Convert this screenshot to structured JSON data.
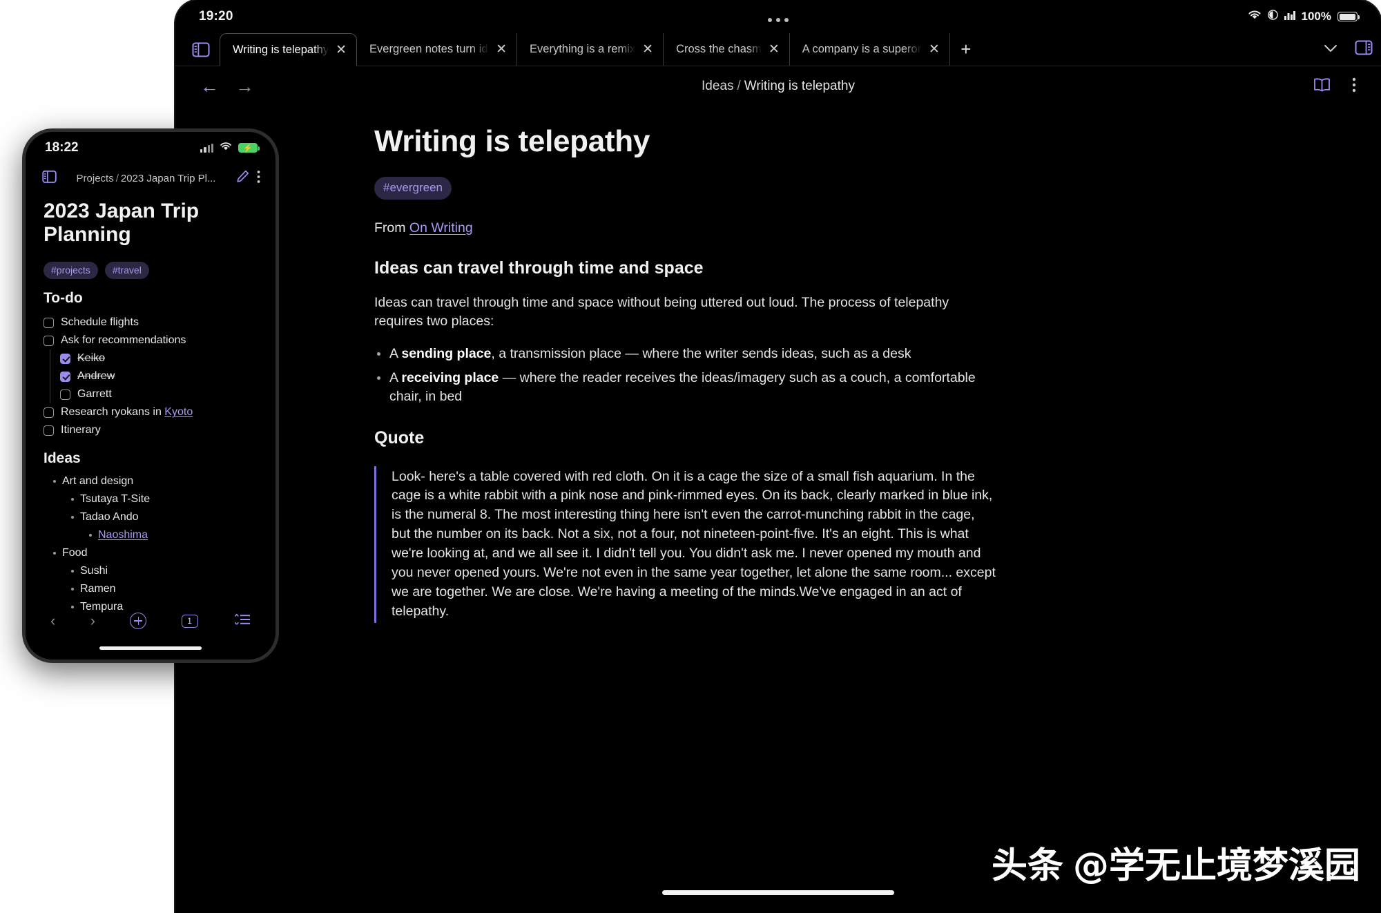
{
  "tablet": {
    "status": {
      "clock": "19:20",
      "battery_percent": "100%",
      "icons": [
        "wifi-icon",
        "moon-circle-icon",
        "signal-bars-icon",
        "battery-icon"
      ]
    },
    "overflow_dots": "•••",
    "tabs": [
      {
        "label": "Writing is telepathy",
        "active": true,
        "close": "✕"
      },
      {
        "label": "Evergreen notes turn ide",
        "active": false,
        "close": "✕"
      },
      {
        "label": "Everything is a remix",
        "active": false,
        "close": "✕"
      },
      {
        "label": "Cross the chasm",
        "active": false,
        "close": "✕"
      },
      {
        "label": "A company is a superorg",
        "active": false,
        "close": "✕"
      }
    ],
    "new_tab_label": "+",
    "tabstrip_right": {
      "chevron": "⌄",
      "right_sidebar_icon": "right-panel-icon"
    },
    "toolbar": {
      "back": "←",
      "forward": "→",
      "breadcrumb_first": "Ideas",
      "breadcrumb_sep": "/",
      "breadcrumb_last": "Writing is telepathy",
      "read_icon": "book-icon",
      "more_icon": "more-vertical-icon"
    },
    "note": {
      "title": "Writing is telepathy",
      "tag": "#evergreen",
      "from_prefix": "From ",
      "from_link": "On Writing",
      "heading1": "Ideas can travel through time and space",
      "paragraph1": "Ideas can travel through time and space without being uttered out loud. The process of telepathy requires two places:",
      "bullets": [
        {
          "pre": "A ",
          "bold": "sending place",
          "post": ", a transmission place — where the writer sends ideas, such as a desk"
        },
        {
          "pre": "A ",
          "bold": "receiving place",
          "post": " — where the reader receives the ideas/imagery such as a couch, a comfortable chair, in bed"
        }
      ],
      "heading2": "Quote",
      "quote": "Look- here's a table covered with red cloth. On it is a cage the size of a small fish aquarium. In the cage is a white rabbit with a pink nose and pink-rimmed eyes. On its back, clearly marked in blue ink, is the numeral 8. The most interesting thing here isn't even the carrot-munching rabbit in the cage, but the number on its back. Not a six, not a four, not nineteen-point-five. It's an eight. This is what we're looking at, and we all see it. I didn't tell you. You didn't ask me. I never opened my mouth and you never opened yours. We're not even in the same year together, let alone the same room... except we are together. We are close. We're having a meeting of the minds.We've engaged in an act of telepathy."
    }
  },
  "phone": {
    "status": {
      "clock": "18:22",
      "icons": [
        "signal-bars-icon",
        "wifi-icon",
        "battery-charging-icon"
      ],
      "battery_glyph": "⚡"
    },
    "toolbar": {
      "sidebar_icon": "left-panel-icon",
      "breadcrumb_first": "Projects",
      "breadcrumb_sep": "/",
      "breadcrumb_last": "2023 Japan Trip Pl...",
      "edit_icon": "pencil-icon",
      "more_icon": "more-vertical-icon"
    },
    "note": {
      "title": "2023 Japan Trip Planning",
      "tags": [
        "#projects",
        "#travel"
      ],
      "todo_heading": "To-do",
      "todos": [
        {
          "label": "Schedule flights",
          "checked": false,
          "indent": 0
        },
        {
          "label": "Ask for recommendations",
          "checked": false,
          "indent": 0
        },
        {
          "label": "Keiko",
          "checked": true,
          "indent": 1
        },
        {
          "label": "Andrew",
          "checked": true,
          "indent": 1
        },
        {
          "label": "Garrett",
          "checked": false,
          "indent": 1
        },
        {
          "label": "Research ryokans in ",
          "link": "Kyoto",
          "checked": false,
          "indent": 0
        },
        {
          "label": "Itinerary",
          "checked": false,
          "indent": 0
        }
      ],
      "ideas_heading": "Ideas",
      "ideas": [
        {
          "label": "Art and design",
          "level": 1,
          "link": false
        },
        {
          "label": "Tsutaya T-Site",
          "level": 2,
          "link": false
        },
        {
          "label": "Tadao Ando",
          "level": 2,
          "link": false
        },
        {
          "label": "Naoshima",
          "level": 3,
          "link": true
        },
        {
          "label": "Food",
          "level": 1,
          "link": false
        },
        {
          "label": "Sushi",
          "level": 2,
          "link": false
        },
        {
          "label": "Ramen",
          "level": 2,
          "link": false
        },
        {
          "label": "Tempura",
          "level": 2,
          "link": false
        }
      ]
    },
    "bottombar": {
      "prev": "‹",
      "next": "›",
      "add_icon": "plus-circle-icon",
      "page_count": "1",
      "outline_icon": "outline-list-icon"
    }
  },
  "watermark": {
    "brand": "头条",
    "handle": "@学无止境梦溪园"
  },
  "colors": {
    "accent": "#9b8df0",
    "pill_bg": "#2b2744",
    "pill_text": "#a79bf0",
    "bg": "#000000"
  }
}
